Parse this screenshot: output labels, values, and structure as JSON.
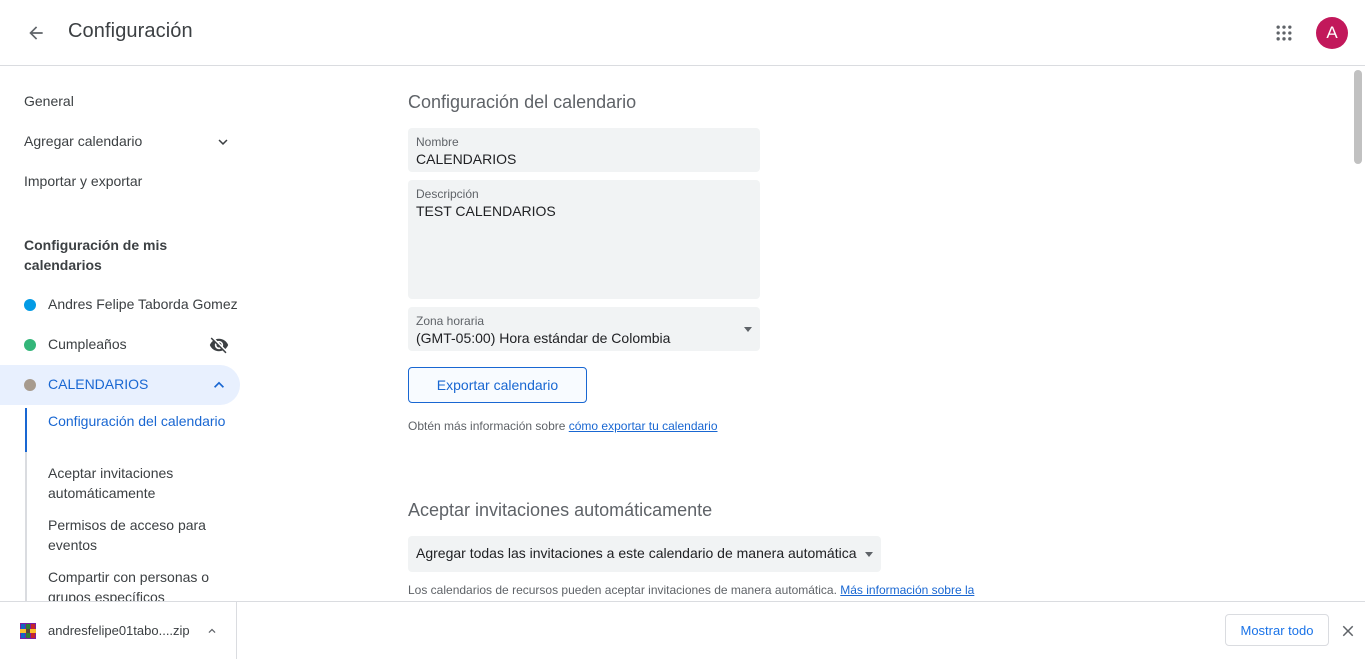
{
  "header": {
    "title": "Configuración",
    "avatar_letter": "A"
  },
  "sidebar": {
    "general": "General",
    "add_calendar": "Agregar calendario",
    "import_export": "Importar y exportar",
    "my_calendars_title": "Configuración de mis calendarios",
    "calendars": [
      {
        "name": "Andres Felipe Taborda Gomez",
        "color": "#039be5"
      },
      {
        "name": "Cumpleaños",
        "color": "#33b679"
      },
      {
        "name": "CALENDARIOS",
        "color": "#a79b8e"
      }
    ],
    "sub_items": [
      "Configuración del calendario",
      "Aceptar invitaciones automáticamente",
      "Permisos de acceso para eventos",
      "Compartir con personas o grupos específicos"
    ]
  },
  "main": {
    "calendar_settings_title": "Configuración del calendario",
    "name_label": "Nombre",
    "name_value": "CALENDARIOS",
    "description_label": "Descripción",
    "description_value": "TEST CALENDARIOS",
    "timezone_label": "Zona horaria",
    "timezone_value": "(GMT-05:00) Hora estándar de Colombia",
    "export_button": "Exportar calendario",
    "export_help_prefix": "Obtén más información sobre ",
    "export_help_link": "cómo exportar tu calendario",
    "auto_accept_title": "Aceptar invitaciones automáticamente",
    "auto_accept_value": "Agregar todas las invitaciones a este calendario de manera automática",
    "auto_accept_help_prefix": "Los calendarios de recursos pueden aceptar invitaciones de manera automática. ",
    "auto_accept_help_link": "Más información sobre la aceptación automática de invitaciones"
  },
  "downloads": {
    "file_name": "andresfelipe01tabo....zip",
    "show_all": "Mostrar todo"
  }
}
